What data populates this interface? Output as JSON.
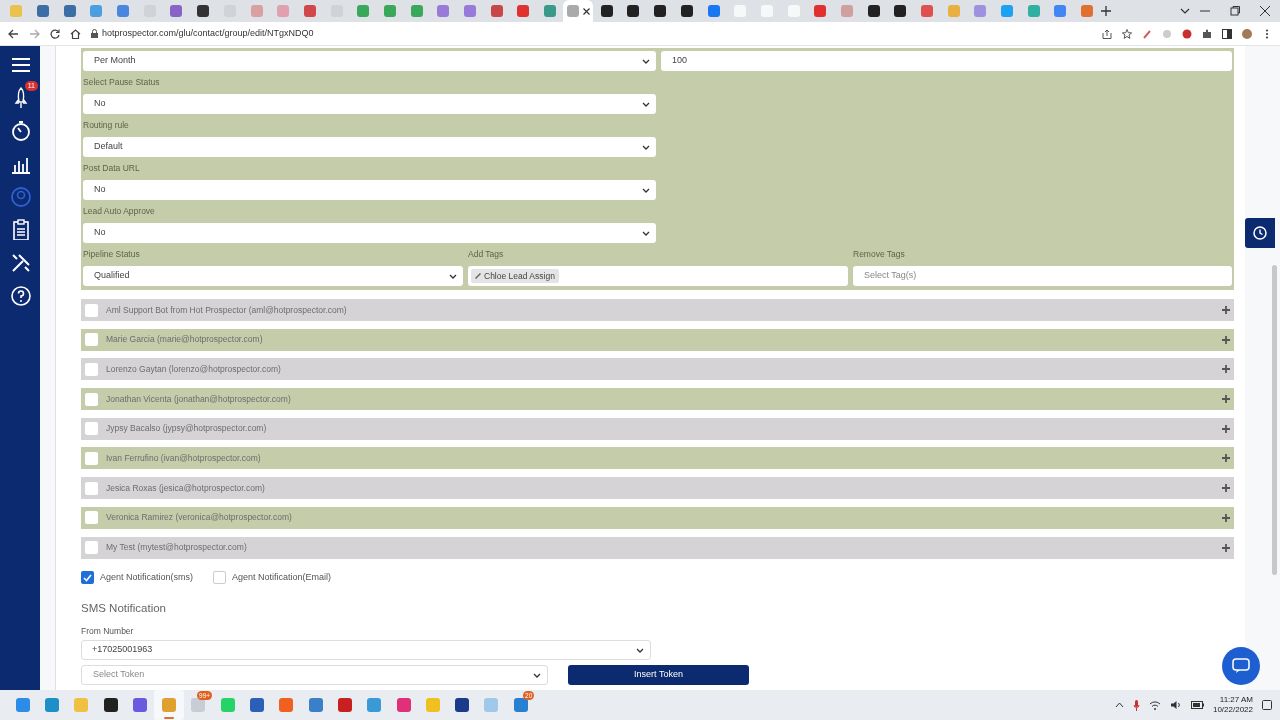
{
  "browser": {
    "tabs": [
      {
        "color": "#e8c24a",
        "selected": false
      },
      {
        "color": "#3a6ea5",
        "selected": false
      },
      {
        "color": "#3a6ea5",
        "selected": false
      },
      {
        "color": "#4a9fe0",
        "selected": false
      },
      {
        "color": "#4a86e0",
        "selected": false
      },
      {
        "color": "#cfd3d8",
        "selected": false
      },
      {
        "color": "#8a63c8",
        "selected": false
      },
      {
        "color": "#333333",
        "selected": false
      },
      {
        "color": "#cfd3d8",
        "selected": false
      },
      {
        "color": "#d8a0a0",
        "selected": false
      },
      {
        "color": "#e0a0b0",
        "selected": false
      },
      {
        "color": "#d04848",
        "selected": false
      },
      {
        "color": "#cfd3d8",
        "selected": false
      },
      {
        "color": "#3aa85a",
        "selected": false
      },
      {
        "color": "#3aa85a",
        "selected": false
      },
      {
        "color": "#3aa85a",
        "selected": false
      },
      {
        "color": "#9a7ad8",
        "selected": false
      },
      {
        "color": "#9a7ad8",
        "selected": false
      },
      {
        "color": "#c84848",
        "selected": false
      },
      {
        "color": "#e03030",
        "selected": false
      },
      {
        "color": "#3a9a8a",
        "selected": false
      },
      {
        "color": "#aaaaaa",
        "selected": true
      },
      {
        "color": "#222222",
        "selected": false
      },
      {
        "color": "#222222",
        "selected": false
      },
      {
        "color": "#222222",
        "selected": false
      },
      {
        "color": "#222222",
        "selected": false
      },
      {
        "color": "#1877f2",
        "selected": false
      },
      {
        "color": "#f7f8f9",
        "selected": false
      },
      {
        "color": "#f7f8f9",
        "selected": false
      },
      {
        "color": "#f7f8f9",
        "selected": false
      },
      {
        "color": "#e03030",
        "selected": false
      },
      {
        "color": "#d0a0a0",
        "selected": false
      },
      {
        "color": "#222222",
        "selected": false
      },
      {
        "color": "#222222",
        "selected": false
      },
      {
        "color": "#e05050",
        "selected": false
      },
      {
        "color": "#e8b040",
        "selected": false
      },
      {
        "color": "#a090e0",
        "selected": false
      },
      {
        "color": "#1da1f2",
        "selected": false
      },
      {
        "color": "#30b0a0",
        "selected": false
      },
      {
        "color": "#4285f4",
        "selected": false
      },
      {
        "color": "#e07030",
        "selected": false
      }
    ],
    "url": "hotprospector.com/glu/contact/group/edit/NTgxNDQ0"
  },
  "sidebar": {
    "items": [
      {
        "kind": "menu",
        "selected": false
      },
      {
        "kind": "rocket",
        "selected": false,
        "badge": "11"
      },
      {
        "kind": "timer",
        "selected": false
      },
      {
        "kind": "chart",
        "selected": false
      },
      {
        "kind": "contact",
        "selected": true
      },
      {
        "kind": "clipboard",
        "selected": false
      },
      {
        "kind": "tools",
        "selected": false
      },
      {
        "kind": "help",
        "selected": false
      }
    ]
  },
  "form": {
    "rate": {
      "value": "Per Month"
    },
    "limit": {
      "value": "100"
    },
    "fields": [
      {
        "label": "Select Pause Status",
        "value": "No"
      },
      {
        "label": "Routing rule",
        "value": "Default"
      },
      {
        "label": "Post Data URL",
        "value": "No"
      },
      {
        "label": "Lead Auto Approve",
        "value": "No"
      }
    ],
    "pipeline": {
      "label": "Pipeline Status",
      "value": "Qualified"
    },
    "add_tags": {
      "label": "Add Tags",
      "tags": [
        "Chloe Lead Assign"
      ]
    },
    "remove_tags": {
      "label": "Remove Tags",
      "placeholder": "Select Tag(s)"
    }
  },
  "agents": [
    {
      "name": "Aml Support Bot from Hot Prospector (aml@hotprospector.com)",
      "checked": false
    },
    {
      "name": "Marie Garcia (marie@hotprospector.com)",
      "checked": false
    },
    {
      "name": "Lorenzo Gaytan (lorenzo@hotprospector.com)",
      "checked": false
    },
    {
      "name": "Jonathan Vicenta (jonathan@hotprospector.com)",
      "checked": false
    },
    {
      "name": "Jypsy Bacalso (jypsy@hotprospector.com)",
      "checked": false
    },
    {
      "name": "Ivan Ferrufino (ivan@hotprospector.com)",
      "checked": false
    },
    {
      "name": "Jesica Roxas (jesica@hotprospector.com)",
      "checked": false
    },
    {
      "name": "Veronica Ramirez (veronica@hotprospector.com)",
      "checked": false
    },
    {
      "name": "My Test (mytest@hotprospector.com)",
      "checked": false
    }
  ],
  "notifications": [
    {
      "label": "Agent Notification(sms)",
      "checked": true
    },
    {
      "label": "Agent Notification(Email)",
      "checked": false
    }
  ],
  "sms": {
    "heading": "SMS Notification",
    "from_label": "From Number",
    "from_value": "+17025001963",
    "token_placeholder": "Select Token",
    "insert_button": "Insert Token"
  },
  "taskbar": {
    "apps": [
      {
        "color": "#2b8de8",
        "selected": false
      },
      {
        "color": "#1e90c8",
        "selected": false
      },
      {
        "color": "#f0c040",
        "selected": false
      },
      {
        "color": "#222222",
        "selected": false
      },
      {
        "color": "#6a5ae0",
        "selected": false
      },
      {
        "color": "#e0a030",
        "selected": true
      },
      {
        "color": "#c8ccd4",
        "selected": false,
        "badge": "99+"
      },
      {
        "color": "#25d366",
        "selected": false
      },
      {
        "color": "#2b5fb8",
        "selected": false
      },
      {
        "color": "#f06020",
        "selected": false
      },
      {
        "color": "#3a80c8",
        "selected": false
      },
      {
        "color": "#c82020",
        "selected": false
      },
      {
        "color": "#3a9ad8",
        "selected": false
      },
      {
        "color": "#e0307a",
        "selected": false
      },
      {
        "color": "#f0c020",
        "selected": false
      },
      {
        "color": "#1a3a8a",
        "selected": false
      },
      {
        "color": "#a0c8e8",
        "selected": false
      },
      {
        "color": "#2a80d0",
        "selected": false,
        "badge": "20"
      }
    ],
    "time": "11:27 AM",
    "date": "10/22/2022"
  }
}
